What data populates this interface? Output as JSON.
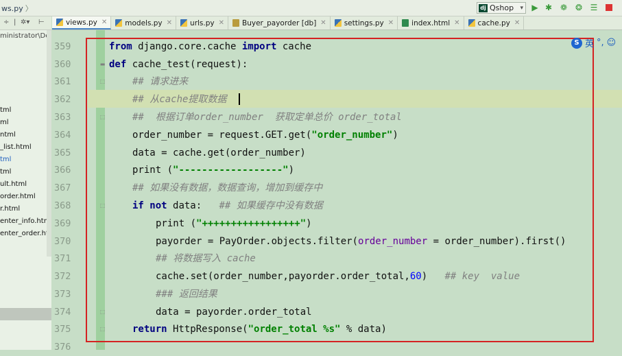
{
  "breadcrumb": {
    "text": "ws.py"
  },
  "run_config": {
    "label": "Qshop",
    "badge": "dj"
  },
  "project_panel": {
    "root_path": "ministrator\\De",
    "items": [
      {
        "label": "tml"
      },
      {
        "label": "ml"
      },
      {
        "label": "ntml"
      },
      {
        "label": "_list.html"
      },
      {
        "label": "tml"
      },
      {
        "label": "tml"
      },
      {
        "label": "ult.html"
      },
      {
        "label": "order.html"
      },
      {
        "label": "r.html"
      },
      {
        "label": "enter_info.html"
      },
      {
        "label": "enter_order.htm"
      }
    ]
  },
  "tabs": [
    {
      "label": "views.py",
      "type": "py",
      "active": true
    },
    {
      "label": "models.py",
      "type": "py",
      "active": false
    },
    {
      "label": "urls.py",
      "type": "py",
      "active": false
    },
    {
      "label": "Buyer_payorder [db]",
      "type": "db",
      "active": false
    },
    {
      "label": "settings.py",
      "type": "py",
      "active": false
    },
    {
      "label": "index.html",
      "type": "html",
      "active": false
    },
    {
      "label": "cache.py",
      "type": "py",
      "active": false
    }
  ],
  "ime": {
    "label": "英"
  },
  "editor": {
    "current_line": "362",
    "lines": [
      {
        "n": "359",
        "t": "from django.core.cache import cache"
      },
      {
        "n": "360",
        "t": "def cache_test(request):"
      },
      {
        "n": "361",
        "t": "## 请求进来"
      },
      {
        "n": "362",
        "t": "## 从cache提取数据"
      },
      {
        "n": "363",
        "t": "##  根据订单order_number  获取定单总价 order_total"
      },
      {
        "n": "364",
        "t": "order_number = request.GET.get(\"order_number\")"
      },
      {
        "n": "365",
        "t": "data = cache.get(order_number)"
      },
      {
        "n": "366",
        "t": "print (\"------------------\")"
      },
      {
        "n": "367",
        "t": "## 如果没有数据，数据查询，增加到缓存中"
      },
      {
        "n": "368",
        "t": "if not data:   ## 如果缓存中没有数据"
      },
      {
        "n": "369",
        "t": "print (\"+++++++++++++++++\")"
      },
      {
        "n": "370",
        "t": "payorder = PayOrder.objects.filter(order_number = order_number).first()"
      },
      {
        "n": "371",
        "t": "## 将数据写入 cache"
      },
      {
        "n": "372",
        "t": "cache.set(order_number,payorder.order_total,60)   ## key  value"
      },
      {
        "n": "373",
        "t": "### 返回结果"
      },
      {
        "n": "374",
        "t": "data = payorder.order_total"
      },
      {
        "n": "375",
        "t": "return HttpResponse(\"order_total %s\" % data)"
      },
      {
        "n": "376",
        "t": ""
      }
    ]
  },
  "colors": {
    "editor_bg": "#c7dec7",
    "keyword": "#000080",
    "comment": "#808080",
    "string": "#008000",
    "number": "#0000ff",
    "highlight_box": "#d42222"
  }
}
